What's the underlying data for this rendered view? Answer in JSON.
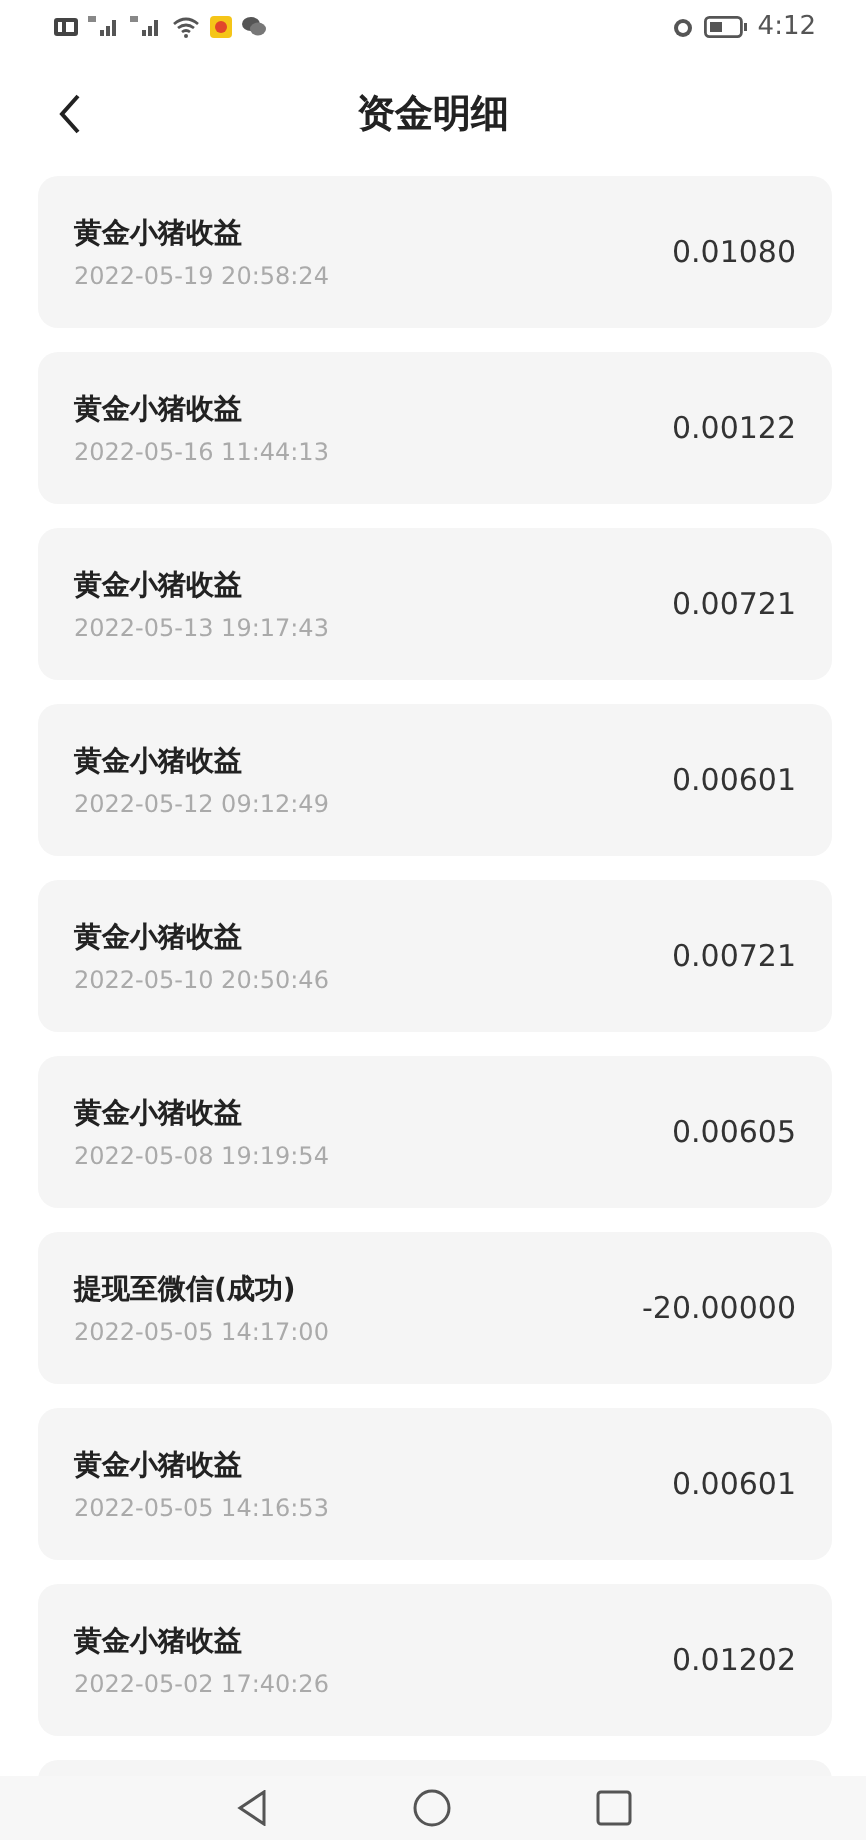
{
  "status_bar": {
    "time": "4:12"
  },
  "header": {
    "title": "资金明细"
  },
  "records": [
    {
      "title": "黄金小猪收益",
      "time": "2022-05-19 20:58:24",
      "amount": "0.01080"
    },
    {
      "title": "黄金小猪收益",
      "time": "2022-05-16 11:44:13",
      "amount": "0.00122"
    },
    {
      "title": "黄金小猪收益",
      "time": "2022-05-13 19:17:43",
      "amount": "0.00721"
    },
    {
      "title": "黄金小猪收益",
      "time": "2022-05-12 09:12:49",
      "amount": "0.00601"
    },
    {
      "title": "黄金小猪收益",
      "time": "2022-05-10 20:50:46",
      "amount": "0.00721"
    },
    {
      "title": "黄金小猪收益",
      "time": "2022-05-08 19:19:54",
      "amount": "0.00605"
    },
    {
      "title": "提现至微信(成功)",
      "time": "2022-05-05 14:17:00",
      "amount": "-20.00000"
    },
    {
      "title": "黄金小猪收益",
      "time": "2022-05-05 14:16:53",
      "amount": "0.00601"
    },
    {
      "title": "黄金小猪收益",
      "time": "2022-05-02 17:40:26",
      "amount": "0.01202"
    }
  ]
}
